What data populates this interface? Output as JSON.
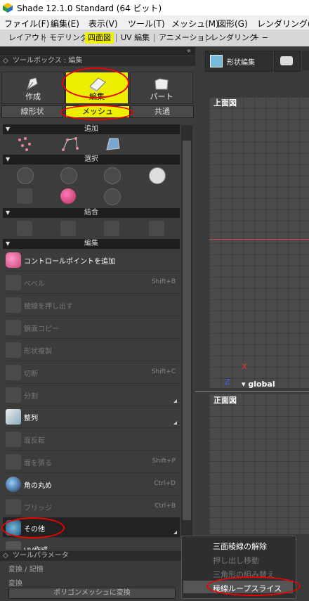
{
  "window": {
    "title": "Shade 12.1.0 Standard (64 ビット)"
  },
  "menubar": {
    "items": [
      "ファイル(F)",
      "編集(E)",
      "表示(V)",
      "ツール(T)",
      "メッシュ(M)",
      "図形(G)",
      "レンダリング(R)"
    ]
  },
  "tabs": {
    "items": [
      "レイアウト",
      "モデリング",
      "四面図",
      "UV 編集",
      "アニメーション",
      "レンダリング"
    ],
    "active": "四面図",
    "extra": "+ −"
  },
  "toolbox": {
    "header": "ツールボックス : 編集",
    "modes": [
      "作成",
      "編集",
      "パート"
    ],
    "active_mode": "編集",
    "submodes": [
      "線形状",
      "メッシュ",
      "共通"
    ],
    "active_submode": "メッシュ",
    "sections": {
      "add": "追加",
      "select": "選択",
      "join": "結合",
      "edit": "編集"
    },
    "tools": [
      {
        "name": "コントロールポイントを追加",
        "shortcut": "",
        "enabled": true,
        "icon": "add-point-icon"
      },
      {
        "name": "ベベル",
        "shortcut": "Shift+B",
        "enabled": false,
        "icon": "bevel-icon"
      },
      {
        "name": "稜線を押し出す",
        "shortcut": "",
        "enabled": false,
        "icon": "extrude-edge-icon"
      },
      {
        "name": "鏡面コピー",
        "shortcut": "",
        "enabled": false,
        "icon": "mirror-copy-icon"
      },
      {
        "name": "形状複製",
        "shortcut": "",
        "enabled": false,
        "icon": "duplicate-icon"
      },
      {
        "name": "切断",
        "shortcut": "Shift+C",
        "enabled": false,
        "icon": "cut-icon"
      },
      {
        "name": "分割",
        "shortcut": "",
        "enabled": false,
        "icon": "split-icon"
      },
      {
        "name": "整列",
        "shortcut": "",
        "enabled": true,
        "icon": "align-icon"
      },
      {
        "name": "面反転",
        "shortcut": "",
        "enabled": false,
        "icon": "flip-face-icon"
      },
      {
        "name": "面を張る",
        "shortcut": "Shift+P",
        "enabled": false,
        "icon": "fill-face-icon"
      },
      {
        "name": "角の丸め",
        "shortcut": "Ctrl+D",
        "enabled": true,
        "icon": "round-corner-icon"
      },
      {
        "name": "ブリッジ",
        "shortcut": "Ctrl+B",
        "enabled": false,
        "icon": "bridge-icon"
      },
      {
        "name": "その他",
        "shortcut": "",
        "enabled": true,
        "icon": "other-icon"
      },
      {
        "name": "UV作成",
        "shortcut": "",
        "enabled": true,
        "icon": "uv-create-icon"
      }
    ]
  },
  "toolparams": {
    "header": "ツールパラメータ",
    "sub1": "変換 / 記憶",
    "sub2": "変換",
    "button": "ポリゴンメッシュに変換"
  },
  "viewport": {
    "toolbar_button": "形状編集",
    "view_top": "上面図",
    "view_front": "正面図",
    "axis_x": "X",
    "axis_z": "Z",
    "coord_label": "global"
  },
  "popup_menu": {
    "items": [
      "三面稜線の解除",
      "押し出し移動",
      "三角形の組み替え",
      "稜線ループスライス"
    ],
    "selected": "稜線ループスライス"
  },
  "colors": {
    "accent": "#eeee00",
    "highlight_circle": "#e00000",
    "axis_x": "#e03030",
    "axis_z": "#3060ff"
  }
}
